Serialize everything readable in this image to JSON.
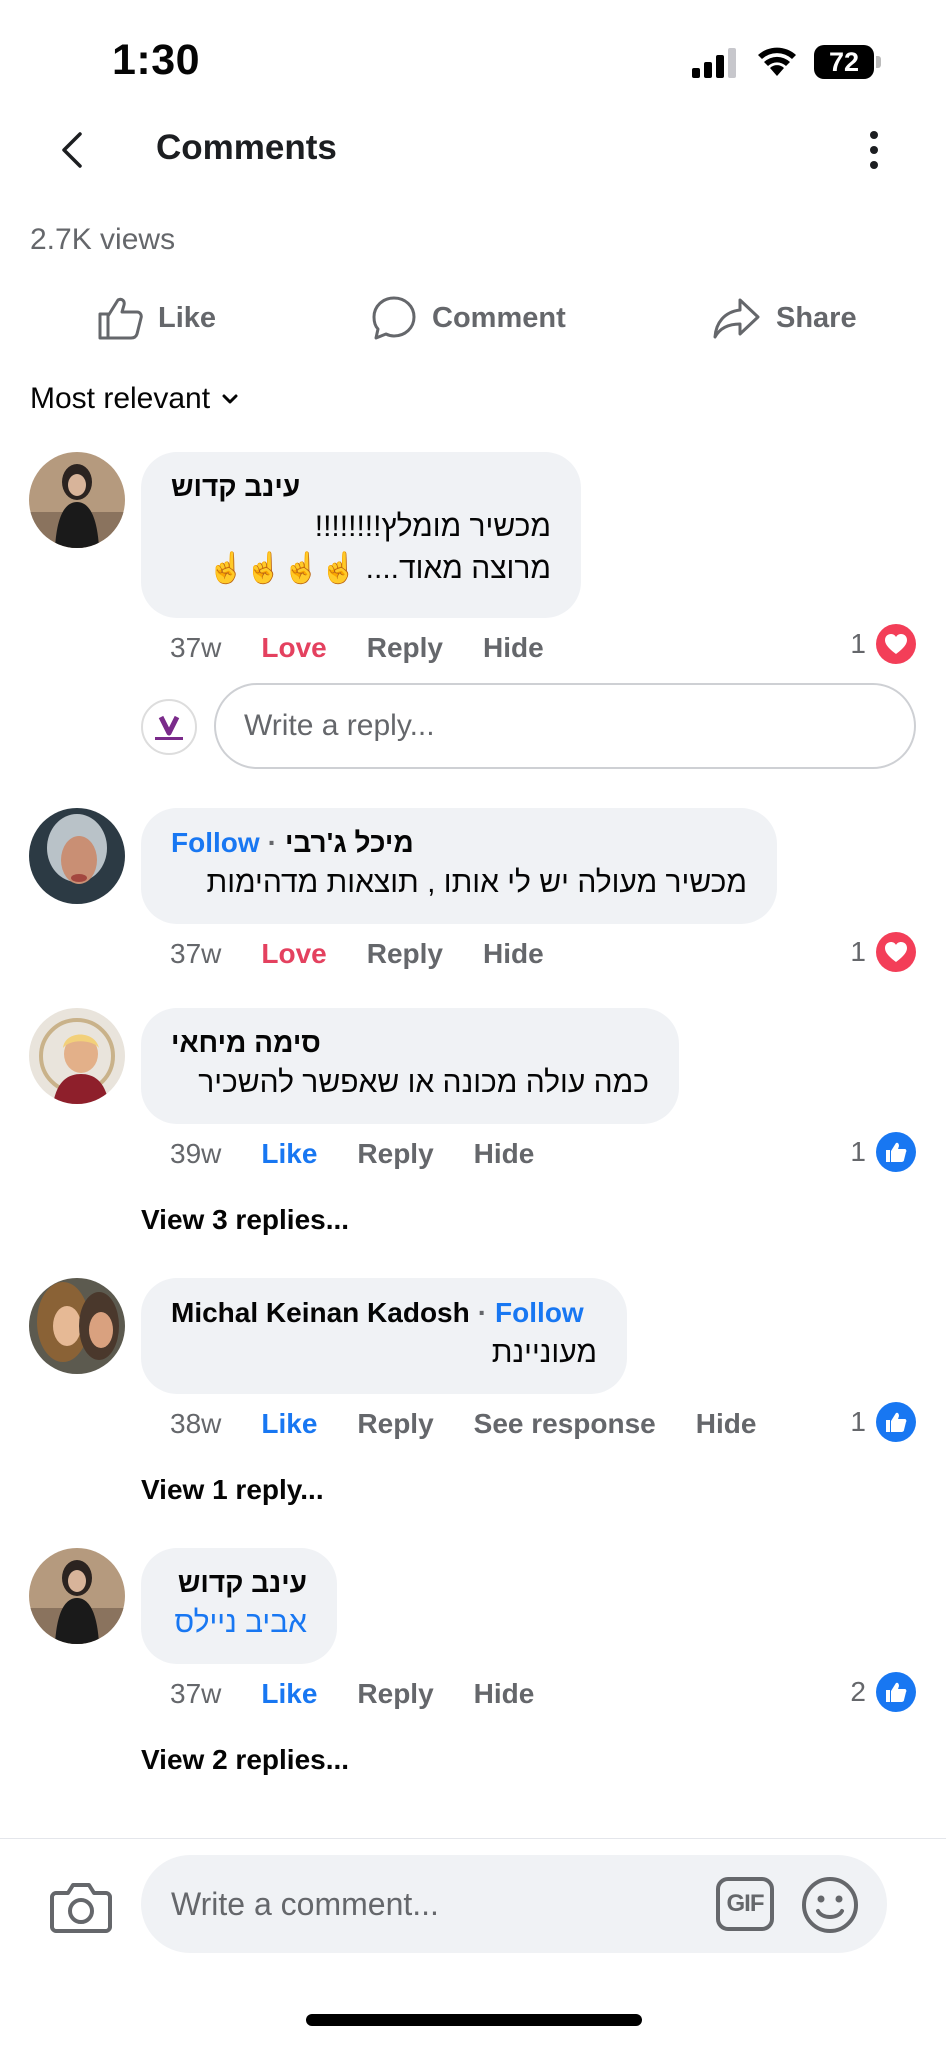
{
  "status_bar": {
    "time": "1:30",
    "battery": "72"
  },
  "header": {
    "title": "Comments"
  },
  "post": {
    "views": "2.7K views"
  },
  "actions": {
    "like": "Like",
    "comment": "Comment",
    "share": "Share"
  },
  "sort": {
    "label": "Most relevant"
  },
  "comments": [
    {
      "author": "עינב קדוש",
      "lines": [
        "מכשיר מומלץ!!!!!!!!",
        "מרוצה מאוד.... ☝️☝️☝️☝️"
      ],
      "time": "37w",
      "reaction_label": "Love",
      "reply": "Reply",
      "hide": "Hide",
      "reaction_count": "1",
      "reaction_type": "love"
    },
    {
      "author": "מיכל ג'רבי",
      "follow": "Follow",
      "lines": [
        "מכשיר מעולה יש לי אותו , תוצאות מדהימות"
      ],
      "time": "37w",
      "reaction_label": "Love",
      "reply": "Reply",
      "hide": "Hide",
      "reaction_count": "1",
      "reaction_type": "love"
    },
    {
      "author": "סימה מיחאי",
      "lines": [
        "כמה עולה מכונה או שאפשר להשכיר"
      ],
      "time": "39w",
      "reaction_label": "Like",
      "reply": "Reply",
      "hide": "Hide",
      "reaction_count": "1",
      "reaction_type": "like",
      "view_replies": "View 3 replies..."
    },
    {
      "author": "Michal Keinan Kadosh",
      "follow": "Follow",
      "lines": [
        "מעוניינת"
      ],
      "time": "38w",
      "reaction_label": "Like",
      "reply": "Reply",
      "see_response": "See response",
      "hide": "Hide",
      "reaction_count": "1",
      "reaction_type": "like",
      "view_replies": "View 1 reply..."
    },
    {
      "author": "עינב קדוש",
      "lines": [
        "אביב ניילס"
      ],
      "time": "37w",
      "reaction_label": "Like",
      "reply": "Reply",
      "hide": "Hide",
      "reaction_count": "2",
      "reaction_type": "like",
      "view_replies": "View 2 replies..."
    }
  ],
  "reply_box": {
    "placeholder": "Write a reply..."
  },
  "composer": {
    "placeholder": "Write a comment...",
    "gif": "GIF"
  },
  "colors": {
    "accent": "#1877f2",
    "love": "#f33e58",
    "bubble": "#f0f2f5",
    "secondary_text": "#65676b"
  }
}
